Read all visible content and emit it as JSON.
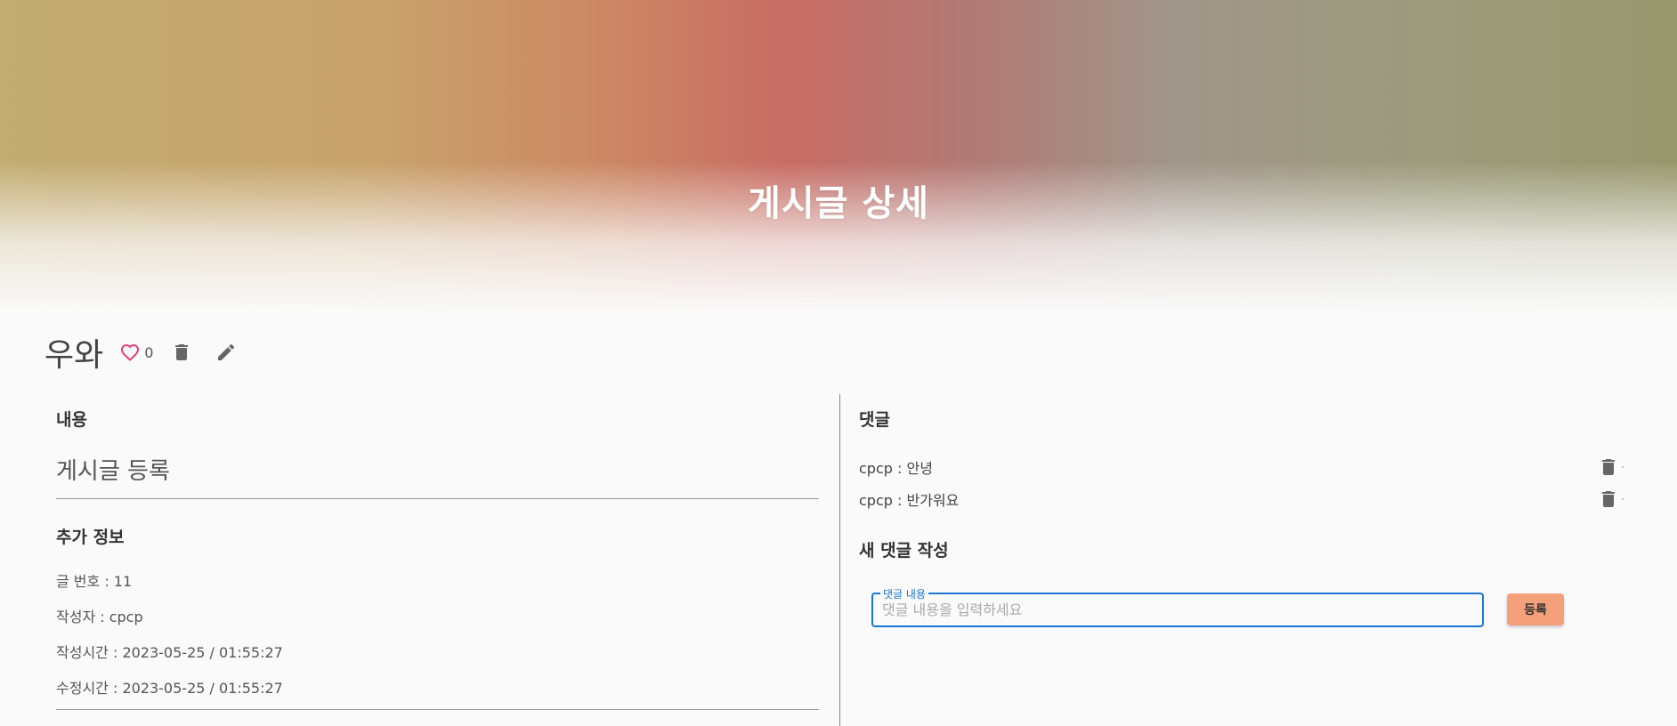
{
  "hero": {
    "title": "게시글 상세"
  },
  "post": {
    "title": "우와",
    "like_count": "0",
    "icons": {
      "like": "heart-outline-icon",
      "delete": "trash-icon",
      "edit": "pencil-icon"
    }
  },
  "content_section": {
    "heading": "내용",
    "body": "게시글 등록"
  },
  "info_section": {
    "heading": "추가 정보",
    "post_number": "글 번호 : 11",
    "author": "작성자 : cpcp",
    "created": "작성시간 : 2023-05-25 / 01:55:27",
    "modified": "수정시간 : 2023-05-25 / 01:55:27"
  },
  "comments": {
    "heading": "댓글",
    "items": [
      {
        "text": "cpcp : 안녕",
        "trailing": "·"
      },
      {
        "text": "cpcp : 반가워요",
        "trailing": "·"
      }
    ]
  },
  "new_comment": {
    "heading": "새 댓글 작성",
    "field_label": "댓글 내용",
    "placeholder": "댓글 내용을 입력하세요",
    "value": "",
    "submit_label": "등록"
  },
  "colors": {
    "accent_blue": "#1976d2",
    "submit_button": "#f4a07a",
    "like_heart": "#e0407a"
  }
}
